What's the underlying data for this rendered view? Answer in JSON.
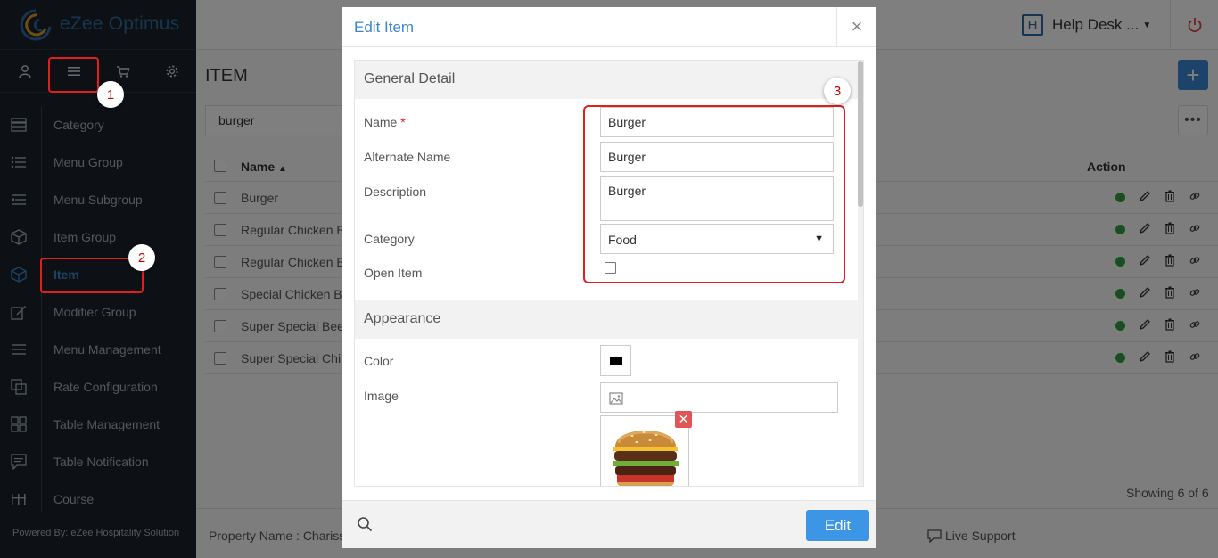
{
  "app": {
    "name": "eZee Optimus",
    "powered_by": "Powered By: eZee Hospitality Solution"
  },
  "topbar": {
    "helpdesk_letter": "H",
    "helpdesk_label": "Help Desk ..."
  },
  "sidebar": {
    "tabs": [
      "user-icon",
      "menu-icon",
      "cart-icon",
      "gear-icon"
    ],
    "menu": [
      {
        "label": "Category",
        "icon": "category-icon"
      },
      {
        "label": "Menu Group",
        "icon": "list-icon"
      },
      {
        "label": "Menu Subgroup",
        "icon": "sublist-icon"
      },
      {
        "label": "Item Group",
        "icon": "box-icon"
      },
      {
        "label": "Item",
        "icon": "cube-icon",
        "active": true
      },
      {
        "label": "Modifier Group",
        "icon": "edit-icon"
      },
      {
        "label": "Menu Management",
        "icon": "hamburger-icon"
      },
      {
        "label": "Rate Configuration",
        "icon": "copy-icon"
      },
      {
        "label": "Table Management",
        "icon": "grid-icon"
      },
      {
        "label": "Table Notification",
        "icon": "chat-icon"
      },
      {
        "label": "Course",
        "icon": "course-icon"
      }
    ]
  },
  "callouts": [
    "1",
    "2",
    "3"
  ],
  "page": {
    "title": "ITEM",
    "search_value": "burger",
    "col_name": "Name",
    "col_action": "Action",
    "rows": [
      "Burger",
      "Regular Chicken B",
      "Regular Chicken B",
      "Special Chicken B",
      "Super Special Bee",
      "Super Special Chi"
    ],
    "showing": "Showing 6 of 6"
  },
  "footer": {
    "property": "Property Name : Chariss",
    "live_support": "Live Support"
  },
  "modal": {
    "title": "Edit Item",
    "close": "×",
    "general_title": "General Detail",
    "name_label": "Name",
    "required_mark": "*",
    "name_value": "Burger",
    "alt_label": "Alternate Name",
    "alt_value": "Burger",
    "desc_label": "Description",
    "desc_value": "Burger",
    "category_label": "Category",
    "category_value": "Food",
    "open_item_label": "Open Item",
    "appearance_title": "Appearance",
    "color_label": "Color",
    "color_value": "#000000",
    "image_label": "Image",
    "edit_button": "Edit"
  },
  "colors": {
    "sidebar_bg": "#1a222b",
    "accent": "#3a87c9",
    "primary_button": "#3d95e6",
    "status_active": "#2e9e3e",
    "callout": "#e02020",
    "power": "#e04040"
  }
}
